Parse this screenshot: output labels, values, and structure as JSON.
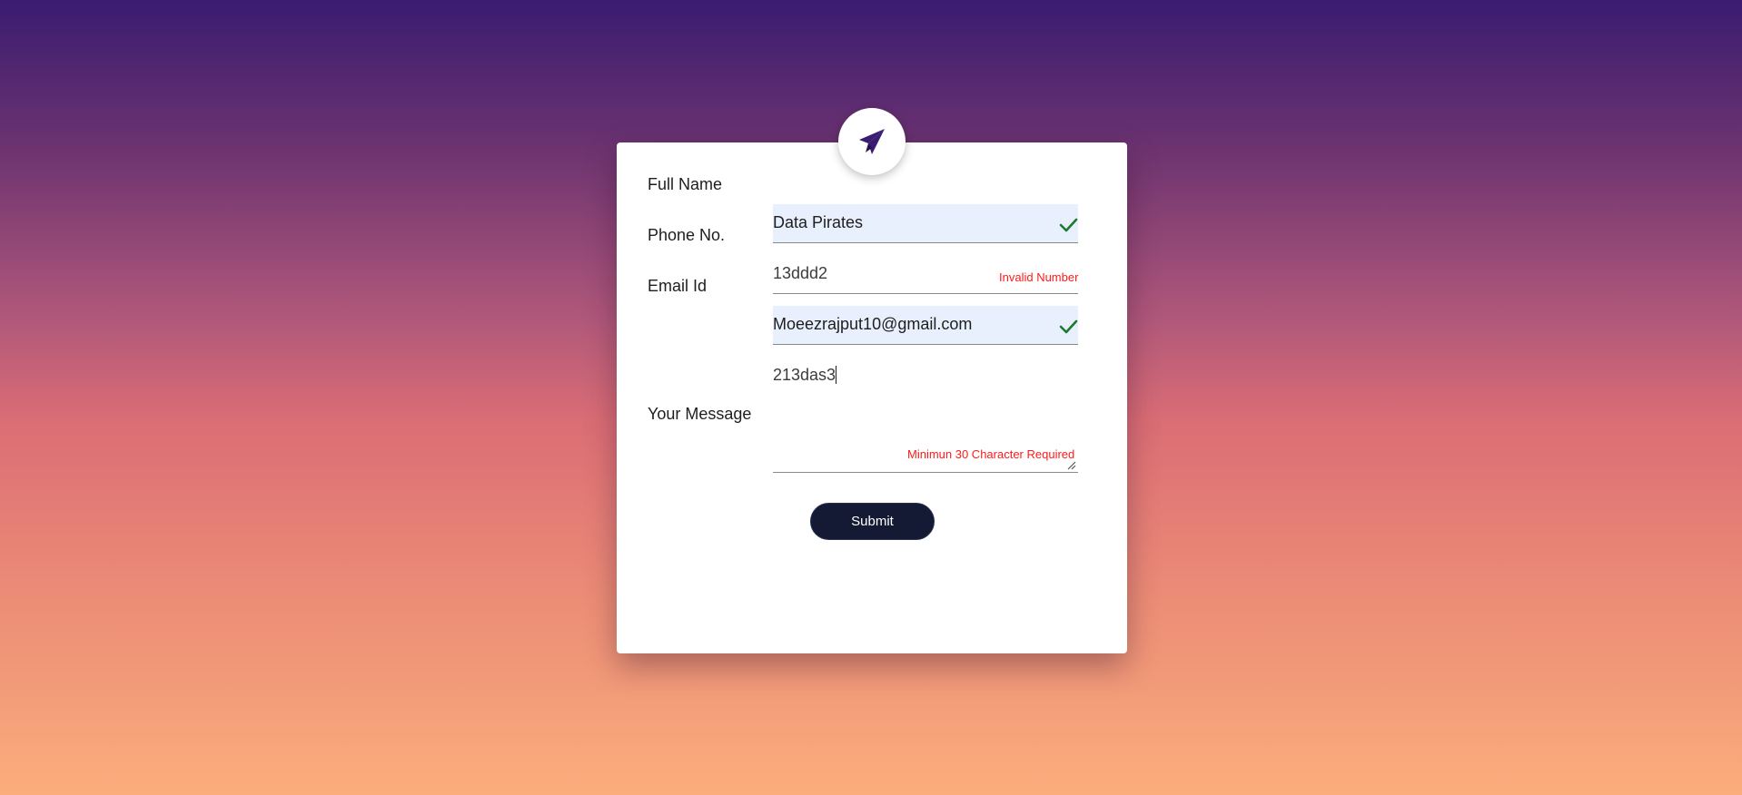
{
  "form": {
    "logo_icon": "paper-plane-icon",
    "accent_color": "#3a1c71",
    "full_name": {
      "label": "Full Name",
      "value": "Data Pirates",
      "status_icon": "check-icon"
    },
    "phone": {
      "label": "Phone No.",
      "value": "13ddd2",
      "error": "Invalid Number"
    },
    "email": {
      "label": "Email Id",
      "value": "Moeezrajput10@gmail.com",
      "status_icon": "check-icon"
    },
    "message": {
      "label": "Your Message",
      "value": "213das3",
      "error": "Minimun 30 Character Required"
    },
    "submit_label": "Submit",
    "valid_color": "#1e7a2e",
    "error_color": "#ff1a1a"
  }
}
